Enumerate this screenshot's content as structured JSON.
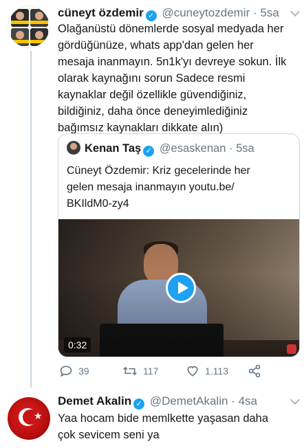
{
  "tweet": {
    "author_name": "cüneyt özdemir",
    "handle": "@cuneytozdemir",
    "separator": "·",
    "time": "5sa",
    "text": "Olağanüstü dönemlerde sosyal medyada her\ngördüğünüze, whats app'dan gelen her\nmesaja inanmayın. 5n1k'yı devreye sokun. İlk\nolarak kaynağını sorun Sadece resmi\nkaynaklar değil özellikle güvendiğiniz,\nbildiğiniz, daha önce deneyimlediğiniz\nbağımsız kaynakları dikkate alın)",
    "quoted": {
      "author_name": "Kenan Taş",
      "handle": "@esaskenan",
      "separator": "·",
      "time": "5sa",
      "text": "Cüneyt Özdemir: Kriz gecelerinde her\ngelen mesaja inanmayın youtu.be/\nBKIldM0-zy4",
      "video_duration": "0:32"
    },
    "actions": {
      "replies": "39",
      "retweets": "117",
      "likes": "1.113"
    }
  },
  "reply": {
    "author_name": "Demet Akalin",
    "handle": "@DemetAkalin",
    "separator": "·",
    "time": "4sa",
    "text": "Yaa hocam bide memlkette yaşasan daha\nçok sevicem seni ya"
  },
  "colors": {
    "verified_blue": "#1da1f2",
    "muted_gray": "#657786",
    "border_gray": "#ccd6dd"
  },
  "icons": [
    "verified-badge-icon",
    "chevron-down-icon",
    "reply-icon",
    "retweet-icon",
    "like-icon",
    "share-icon",
    "play-icon"
  ]
}
